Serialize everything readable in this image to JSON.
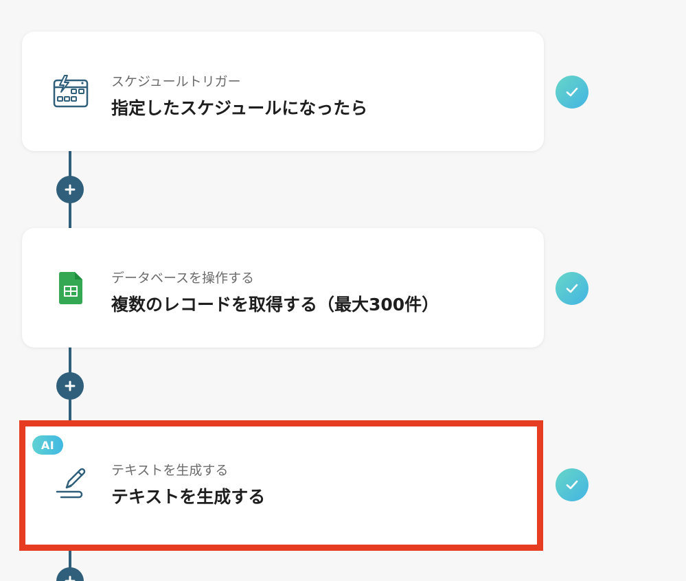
{
  "flow": {
    "steps": [
      {
        "subtitle": "スケジュールトリガー",
        "title": "指定したスケジュールになったら",
        "icon": "calendar-schedule-icon",
        "status": "completed"
      },
      {
        "subtitle": "データベースを操作する",
        "title": "複数のレコードを取得する（最大300件）",
        "icon": "google-sheets-icon",
        "status": "completed"
      },
      {
        "subtitle": "テキストを生成する",
        "title": "テキストを生成する",
        "icon": "pen-write-icon",
        "badge": "AI",
        "status": "completed"
      }
    ]
  },
  "colors": {
    "connector": "#2f5f7a",
    "highlight": "#e53c22",
    "check_start": "#67d6c7",
    "check_end": "#43b4e3",
    "sheets_green": "#34a853"
  }
}
